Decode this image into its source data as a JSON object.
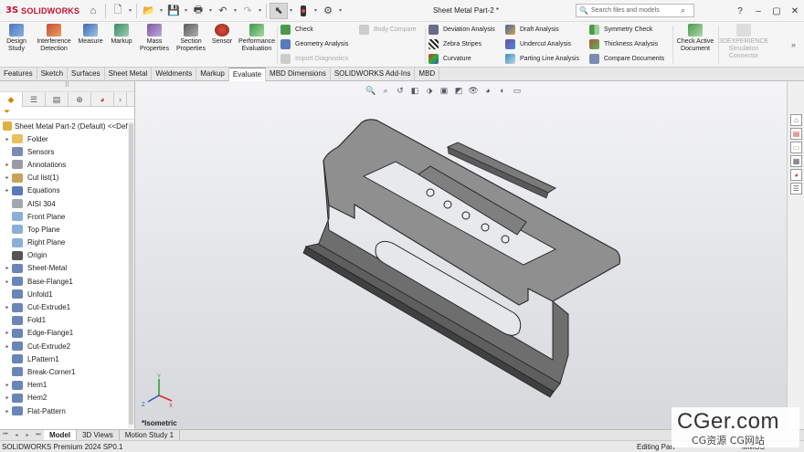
{
  "app": {
    "logo_ds": "3S",
    "logo_name": "SOLIDWORKS",
    "document_title": "Sheet Metal Part-2 *"
  },
  "search": {
    "placeholder": "Search files and models"
  },
  "quick_access": [
    "home-icon",
    "new-document-icon",
    "open-icon",
    "save-icon",
    "print-icon",
    "undo-icon",
    "redo-icon",
    "select-icon",
    "traffic-light-icon",
    "options-icon"
  ],
  "command_manager": {
    "large_buttons": [
      {
        "id": "design-study",
        "label1": "Design",
        "label2": "Study"
      },
      {
        "id": "interference-detection",
        "label1": "Interference",
        "label2": "Detection"
      },
      {
        "id": "measure",
        "label1": "Measure",
        "label2": ""
      },
      {
        "id": "markup",
        "label1": "Markup",
        "label2": ""
      },
      {
        "id": "mass-properties",
        "label1": "Mass",
        "label2": "Properties"
      },
      {
        "id": "section-properties",
        "label1": "Section",
        "label2": "Properties"
      },
      {
        "id": "sensor",
        "label1": "Sensor",
        "label2": ""
      },
      {
        "id": "performance-evaluation",
        "label1": "Performance",
        "label2": "Evaluation"
      }
    ],
    "col1": {
      "check": "Check",
      "geometry_analysis": "Geometry Analysis",
      "body_compare": "Body Compare",
      "import_diagnostics": "Import Diagnostics"
    },
    "col2": {
      "deviation": "Deviation Analysis",
      "zebra": "Zebra Stripes",
      "curvature": "Curvature"
    },
    "col3": {
      "draft": "Draft Analysis",
      "undercut": "Undercut Analysis",
      "parting": "Parting Line Analysis"
    },
    "col4": {
      "symmetry": "Symmetry Check",
      "thickness": "Thickness Analysis",
      "compare": "Compare Documents"
    },
    "check_active": {
      "label1": "Check Active",
      "label2": "Document"
    },
    "experience": {
      "label1": "3DEXPERIENCE",
      "label2": "Simulation",
      "label3": "Connector"
    }
  },
  "tabs": [
    "Features",
    "Sketch",
    "Surfaces",
    "Sheet Metal",
    "Weldments",
    "Markup",
    "Evaluate",
    "MBD Dimensions",
    "SOLIDWORKS Add-Ins",
    "MBD"
  ],
  "active_tab": "Evaluate",
  "feature_tree": {
    "root": "Sheet Metal Part-2 (Default) <<Def",
    "items": [
      {
        "label": "Folder",
        "expand": "▸",
        "color": "#e8c060"
      },
      {
        "label": "Sensors",
        "expand": "",
        "color": "#7a8ab0"
      },
      {
        "label": "Annotations",
        "expand": "▸",
        "color": "#9a9aa6"
      },
      {
        "label": "Cut list(1)",
        "expand": "▸",
        "color": "#c9a25a"
      },
      {
        "label": "Equations",
        "expand": "▸",
        "color": "#5a7abf"
      },
      {
        "label": "AISI 304",
        "expand": "",
        "color": "#a0a8b0"
      },
      {
        "label": "Front Plane",
        "expand": "",
        "color": "#8ab0d8"
      },
      {
        "label": "Top Plane",
        "expand": "",
        "color": "#8ab0d8"
      },
      {
        "label": "Right Plane",
        "expand": "",
        "color": "#8ab0d8"
      },
      {
        "label": "Origin",
        "expand": "",
        "color": "#555555"
      },
      {
        "label": "Sheet-Metal",
        "expand": "▸",
        "color": "#6a86b8"
      },
      {
        "label": "Base-Flange1",
        "expand": "▸",
        "color": "#6a86b8"
      },
      {
        "label": "Unfold1",
        "expand": "",
        "color": "#6a86b8"
      },
      {
        "label": "Cut-Extrude1",
        "expand": "▸",
        "color": "#6a86b8"
      },
      {
        "label": "Fold1",
        "expand": "",
        "color": "#6a86b8"
      },
      {
        "label": "Edge-Flange1",
        "expand": "▸",
        "color": "#6a86b8"
      },
      {
        "label": "Cut-Extrude2",
        "expand": "▸",
        "color": "#6a86b8"
      },
      {
        "label": "LPattern1",
        "expand": "",
        "color": "#6a86b8"
      },
      {
        "label": "Break-Corner1",
        "expand": "",
        "color": "#6a86b8"
      },
      {
        "label": "Hem1",
        "expand": "▸",
        "color": "#6a86b8"
      },
      {
        "label": "Hem2",
        "expand": "▸",
        "color": "#6a86b8"
      },
      {
        "label": "Flat-Pattern",
        "expand": "▸",
        "color": "#6a86b8"
      }
    ]
  },
  "viewport": {
    "view_name": "*Isometric"
  },
  "triad": {
    "x": "X",
    "y": "Y",
    "z": "Z"
  },
  "bottom_tabs": [
    "Model",
    "3D Views",
    "Motion Study 1"
  ],
  "active_bottom_tab": "Model",
  "status": {
    "left": "SOLIDWORKS Premium 2024 SP0.1",
    "right": "Editing Part",
    "units": "MMGS"
  },
  "watermark": {
    "big": "CGer.com",
    "small": "CG资源 CG网站"
  },
  "colors": {
    "brand": "#c8102e",
    "part_face": "#8e8e8e",
    "part_dark": "#4a4a4a",
    "viewport_top": "#f4f4f6",
    "viewport_bottom": "#d6d8dc"
  }
}
